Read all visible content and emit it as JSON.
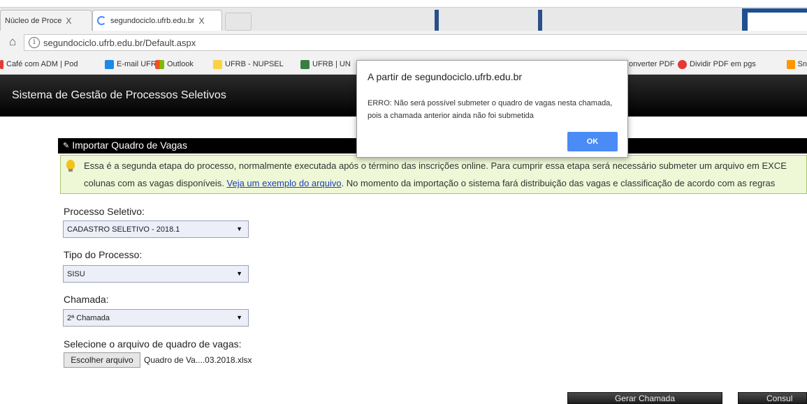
{
  "browser": {
    "tabs": [
      {
        "label": "Núcleo de Proce"
      },
      {
        "label": "segundociclo.ufrb.edu.br"
      }
    ],
    "tab_close_glyph": "X",
    "url": "segundociclo.ufrb.edu.br/Default.aspx",
    "home_icon": "home-icon",
    "info_glyph": "i",
    "bookmarks": [
      {
        "label": "Café com ADM | Pod",
        "icon_color": "#e53935"
      },
      {
        "label": "E-mail UFRB",
        "icon_color": "#1e88e5"
      },
      {
        "label": "Outlook",
        "icon_color": "#f4b400"
      },
      {
        "label": "UFRB - NUPSEL",
        "icon_color": "#f9d342"
      },
      {
        "label": "UFRB | UN",
        "icon_color": "#3a7d44"
      },
      {
        "label": "onverter PDF",
        "icon_color": ""
      },
      {
        "label": "Dividir PDF em pgs",
        "icon_color": "#e53935"
      },
      {
        "label": "Sn",
        "icon_color": "#ff9800"
      }
    ]
  },
  "app": {
    "title": "Sistema de Gestão de Processos Seletivos"
  },
  "panel": {
    "title": "Importar Quadro de Vagas",
    "title_glyph": "✎",
    "notice_line1": "Essa é a segunda etapa do processo, normalmente executada após o término das inscrições online. Para cumprir essa etapa será necessário submeter um arquivo em EXCE",
    "notice_line2_before": "colunas com as vagas disponíveis.",
    "notice_link": "Veja um exemplo do arquivo",
    "notice_line2_after": ". No momento da importação o sistema fará distribuição das vagas e classificação de acordo com as regras"
  },
  "form": {
    "processo_label": "Processo Seletivo:",
    "processo_value": "CADASTRO SELETIVO - 2018.1",
    "tipo_label": "Tipo do Processo:",
    "tipo_value": "SISU",
    "chamada_label": "Chamada:",
    "chamada_value": "2ª Chamada",
    "arrow_glyph": "▼",
    "file_label": "Selecione o arquivo de quadro de vagas:",
    "file_button": "Escolher arquivo",
    "file_name": "Quadro de Va....03.2018.xlsx"
  },
  "actions": {
    "gerar": "Gerar Chamada",
    "consultar": "Consul"
  },
  "dialog": {
    "title": "A partir de segundociclo.ufrb.edu.br",
    "message_line1": "ERRO: Não será possível submeter o quadro de vagas nesta chamada,",
    "message_line2": "pois a chamada anterior ainda não foi submetida",
    "ok": "OK"
  },
  "colors": {
    "header_bg": "#000000",
    "notice_bg": "#eef7d6",
    "select_bg": "#eceef8",
    "ok_button": "#4a8bf5"
  }
}
